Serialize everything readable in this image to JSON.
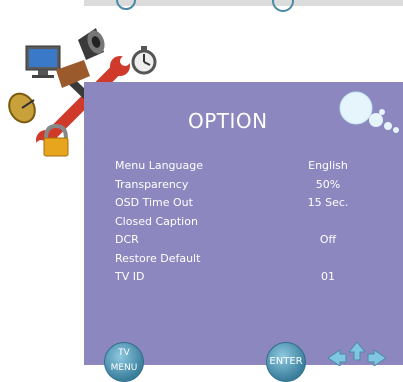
{
  "panel": {
    "title": "OPTION"
  },
  "menu": {
    "items": [
      {
        "label": "Menu Language",
        "value": "English"
      },
      {
        "label": "Transparency",
        "value": "50%"
      },
      {
        "label": "OSD Time Out",
        "value": "15 Sec."
      },
      {
        "label": "Closed Caption",
        "value": ""
      },
      {
        "label": "DCR",
        "value": "Off"
      },
      {
        "label": "Restore Default",
        "value": ""
      },
      {
        "label": "TV ID",
        "value": "01"
      }
    ]
  },
  "bottom": {
    "menu_button": {
      "line1": "TV",
      "line2": "MENU"
    },
    "enter_button": "ENTER"
  },
  "colors": {
    "panel_bg": "#8d87c0",
    "text": "#ffffff",
    "button": "#3b7f9d"
  }
}
